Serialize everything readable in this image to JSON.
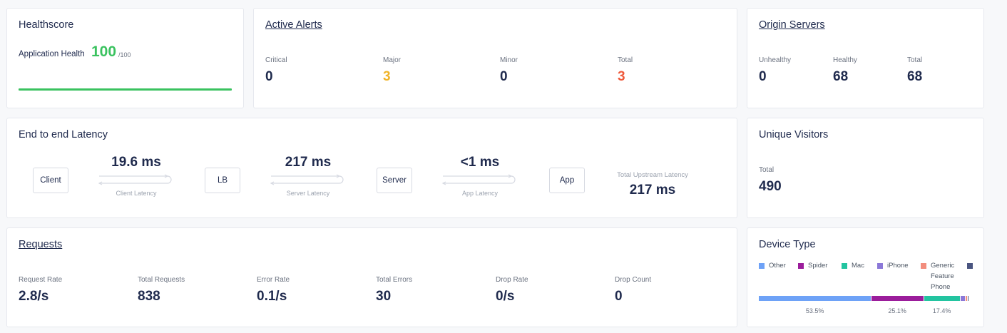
{
  "healthscore": {
    "title": "Healthscore",
    "label": "Application Health",
    "score": "100",
    "max": "/100",
    "color": "#3ac25f"
  },
  "active_alerts": {
    "title": "Active Alerts",
    "stats": [
      {
        "label": "Critical",
        "value": "0",
        "color": "#1f2a4d"
      },
      {
        "label": "Major",
        "value": "3",
        "color": "#f0b429"
      },
      {
        "label": "Minor",
        "value": "0",
        "color": "#1f2a4d"
      },
      {
        "label": "Total",
        "value": "3",
        "color": "#ef5a3c"
      }
    ]
  },
  "origin_servers": {
    "title": "Origin Servers",
    "stats": [
      {
        "label": "Unhealthy",
        "value": "0"
      },
      {
        "label": "Healthy",
        "value": "68"
      },
      {
        "label": "Total",
        "value": "68"
      }
    ]
  },
  "latency": {
    "title": "End to end Latency",
    "nodes": [
      "Client",
      "LB",
      "Server",
      "App"
    ],
    "segments": [
      {
        "value": "19.6 ms",
        "label": "Client Latency"
      },
      {
        "value": "217 ms",
        "label": "Server Latency"
      },
      {
        "value": "<1 ms",
        "label": "App Latency"
      }
    ],
    "total_label": "Total Upstream Latency",
    "total_value": "217 ms"
  },
  "unique_visitors": {
    "title": "Unique Visitors",
    "label": "Total",
    "value": "490"
  },
  "requests": {
    "title": "Requests",
    "stats": [
      {
        "label": "Request Rate",
        "value": "2.8/s"
      },
      {
        "label": "Total Requests",
        "value": "838"
      },
      {
        "label": "Error Rate",
        "value": "0.1/s"
      },
      {
        "label": "Total Errors",
        "value": "30"
      },
      {
        "label": "Drop Rate",
        "value": "0/s"
      },
      {
        "label": "Drop Count",
        "value": "0"
      }
    ]
  },
  "device_type": {
    "title": "Device Type",
    "legend": [
      {
        "name": "Other",
        "color": "#6ea2f7"
      },
      {
        "name": "Spider",
        "color": "#9b1d9b"
      },
      {
        "name": "Mac",
        "color": "#23c4a0"
      },
      {
        "name": "iPhone",
        "color": "#8b78d8"
      },
      {
        "name": "Generic Feature Phone",
        "color": "#f28d7d"
      },
      {
        "name": "",
        "color": "#4a5580"
      }
    ],
    "segments": [
      {
        "percent": 53.5,
        "label": "53.5%",
        "color": "#6ea2f7"
      },
      {
        "percent": 25.1,
        "label": "25.1%",
        "color": "#9b1d9b"
      },
      {
        "percent": 17.4,
        "label": "17.4%",
        "color": "#23c4a0"
      },
      {
        "percent": 2.2,
        "label": "",
        "color": "#8b78d8"
      },
      {
        "percent": 1.0,
        "label": "",
        "color": "#f28d7d"
      },
      {
        "percent": 0.8,
        "label": "",
        "color": "#4a5580"
      }
    ]
  }
}
